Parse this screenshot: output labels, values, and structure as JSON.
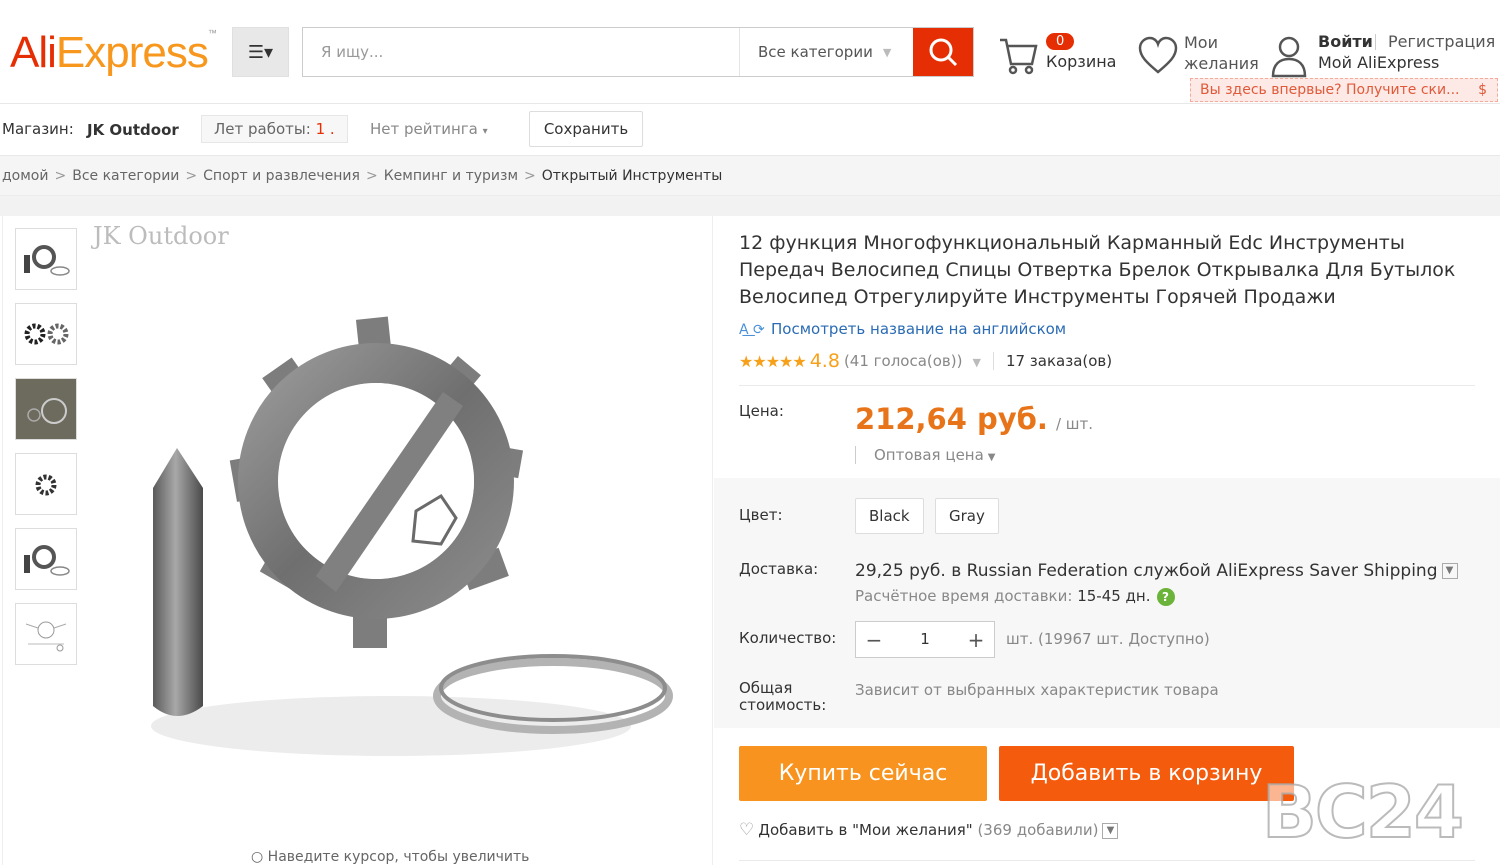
{
  "header": {
    "logo_ali": "Ali",
    "logo_express": "Express",
    "logo_tm": "™",
    "search_placeholder": "Я ищу...",
    "search_category": "Все категории",
    "cart_count": "0",
    "cart_label": "Корзина",
    "wishlist_label": "Мои желания",
    "signin": "Войти",
    "register": "Регистрация",
    "my_account": "Мой AliExpress",
    "promo": "Вы здесь впервые? Получите ски...",
    "promo_symbol": "$"
  },
  "store": {
    "label": "Магазин:",
    "name": "JK Outdoor",
    "years_label": "Лет работы:",
    "years_value": "1 .",
    "rating": "Нет рейтинга",
    "save": "Сохранить"
  },
  "breadcrumb": [
    "домой",
    "Все категории",
    "Спорт и развлечения",
    "Кемпинг и туризм",
    "Открытый Инструменты"
  ],
  "gallery": {
    "watermark": "JK Outdoor",
    "zoom_hint": "Наведите курсор, чтобы увеличить"
  },
  "product": {
    "title": "12 функция Многофункциональный Карманный Edc Инструменты Передач Велосипед Спицы Отвертка Брелок Открывалка Для Бутылок Велосипед Отрегулируйте Инструменты Горячей Продажи",
    "translate_link": "Посмотреть название на английском",
    "stars": "★★★★★",
    "rating": "4.8",
    "votes": "(41 голоса(ов))",
    "orders": "17 заказа(ов)",
    "price_label": "Цена:",
    "price": "212,64 руб.",
    "price_unit": "/ шт.",
    "wholesale": "Оптовая цена",
    "color_label": "Цвет:",
    "colors": [
      "Black",
      "Gray"
    ],
    "shipping_label": "Доставка:",
    "shipping_price": "29,25 руб.",
    "shipping_text": " в Russian Federation службой AliExpress Saver Shipping",
    "delivery_time_label": "Расчётное время доставки:",
    "delivery_time": "15-45 дн.",
    "qty_label": "Количество:",
    "qty_value": "1",
    "qty_note": "шт. (19967 шт. Доступно)",
    "total_label": "Общая стоимость:",
    "total_note": "Зависит от выбранных характеристик товара",
    "buy_now": "Купить сейчас",
    "add_to_cart": "Добавить в корзину",
    "wishlist_add": "Добавить в \"Мои желания\"",
    "wishlist_count": "(369 добавили)"
  },
  "watermark_bc24": "BC24",
  "colors": {
    "brand_red": "#e62e04",
    "price_orange": "#e8741a",
    "buy_orange": "#f7931e",
    "cart_orange": "#f55b0d"
  }
}
